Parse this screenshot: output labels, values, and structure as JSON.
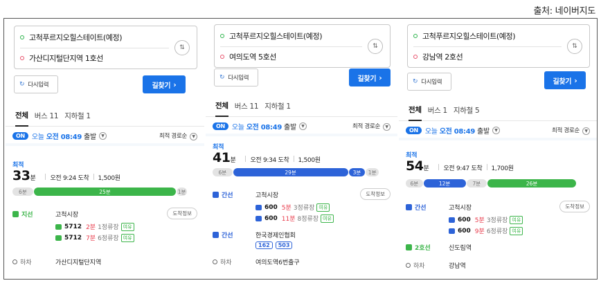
{
  "source_label": "출처: 네이버지도",
  "panels": [
    {
      "origin": "고척푸르지오힐스테이트(예정)",
      "destination": "가산디지털단지역 1호선",
      "reset_label": "다시입력",
      "search_label": "길찾기",
      "tabs": [
        {
          "label": "전체"
        },
        {
          "label": "버스 11"
        },
        {
          "label": "지하철 1"
        }
      ],
      "on_label": "ON",
      "time_prefix": "오늘",
      "time_value": "오전 08:49",
      "time_suffix": "출발",
      "sort_label": "최적 경로순",
      "best_label": "최적",
      "minutes": "33",
      "minutes_unit": "분",
      "arrival": "오전 9:24 도착",
      "fare": "1,500원",
      "bar": [
        {
          "label": "6분",
          "kind": "walk",
          "fraction": 0.12
        },
        {
          "label": "25분",
          "kind": "green",
          "fraction": 0.82
        },
        {
          "label": "1분",
          "kind": "walk",
          "fraction": 0.06
        }
      ],
      "steps": [
        {
          "mode": "지선",
          "color": "green",
          "stop": "고척시장",
          "info": "도착정보",
          "buses": [
            {
              "num": "5712",
              "min": "2분",
              "stops": "1정류장",
              "seat": "여유"
            },
            {
              "num": "5712",
              "min": "7분",
              "stops": "6정류장",
              "seat": "여유"
            }
          ]
        },
        {
          "mode": "하차",
          "color": "gray",
          "stop": "가산디지털단지역"
        }
      ]
    },
    {
      "origin": "고척푸르지오힐스테이트(예정)",
      "destination": "여의도역 5호선",
      "reset_label": "다시입력",
      "search_label": "길찾기",
      "tabs": [
        {
          "label": "전체"
        },
        {
          "label": "버스 11"
        },
        {
          "label": "지하철 1"
        }
      ],
      "on_label": "ON",
      "time_prefix": "오늘",
      "time_value": "오전 08:49",
      "time_suffix": "출발",
      "sort_label": "최적 경로순",
      "best_label": "최적",
      "minutes": "41",
      "minutes_unit": "분",
      "arrival": "오전 9:34 도착",
      "fare": "1,500원",
      "bar": [
        {
          "label": "6분",
          "kind": "walk",
          "fraction": 0.12
        },
        {
          "label": "29분",
          "kind": "blue",
          "fraction": 0.7
        },
        {
          "label": "3분",
          "kind": "blue",
          "fraction": 0.1
        },
        {
          "label": "1분",
          "kind": "walk",
          "fraction": 0.08
        }
      ],
      "steps": [
        {
          "mode": "간선",
          "color": "blue",
          "stop": "고척시장",
          "info": "도착정보",
          "buses": [
            {
              "num": "600",
              "min": "5분",
              "stops": "3정류장",
              "seat": "여유"
            },
            {
              "num": "600",
              "min": "11분",
              "stops": "8정류장",
              "seat": "여유"
            }
          ]
        },
        {
          "mode": "간선",
          "color": "blue",
          "stop": "한국경제인협회",
          "chips": [
            "162",
            "503"
          ]
        },
        {
          "mode": "하차",
          "color": "gray",
          "stop": "여의도역6번출구"
        }
      ]
    },
    {
      "origin": "고척푸르지오힐스테이트(예정)",
      "destination": "강남역 2호선",
      "reset_label": "다시입력",
      "search_label": "길찾기",
      "tabs": [
        {
          "label": "전체"
        },
        {
          "label": "버스 1"
        },
        {
          "label": "지하철 5"
        }
      ],
      "on_label": "ON",
      "time_prefix": "오늘",
      "time_value": "오전 08:49",
      "time_suffix": "출발",
      "sort_label": "최적 경로순",
      "best_label": "최적",
      "minutes": "54",
      "minutes_unit": "분",
      "arrival": "오전 9:47 도착",
      "fare": "1,700원",
      "bar": [
        {
          "label": "6분",
          "kind": "walk",
          "fraction": 0.1
        },
        {
          "label": "12분",
          "kind": "blue",
          "fraction": 0.25
        },
        {
          "label": "7분",
          "kind": "walk",
          "fraction": 0.12
        },
        {
          "label": "26분",
          "kind": "green",
          "fraction": 0.53
        }
      ],
      "steps": [
        {
          "mode": "간선",
          "color": "blue",
          "stop": "고척시장",
          "info": "도착정보",
          "buses": [
            {
              "num": "600",
              "min": "5분",
              "stops": "3정류장",
              "seat": "여유"
            },
            {
              "num": "600",
              "min": "9분",
              "stops": "6정류장",
              "seat": "여유"
            }
          ]
        },
        {
          "mode": "2호선",
          "color": "green",
          "stop": "신도림역"
        },
        {
          "mode": "하차",
          "color": "gray",
          "stop": "강남역"
        }
      ]
    }
  ],
  "colors": {
    "accent": "#1a73e8",
    "bus_green": "#3cb54a",
    "bus_blue": "#2d63d8",
    "remaining_red": "#e8394a"
  }
}
